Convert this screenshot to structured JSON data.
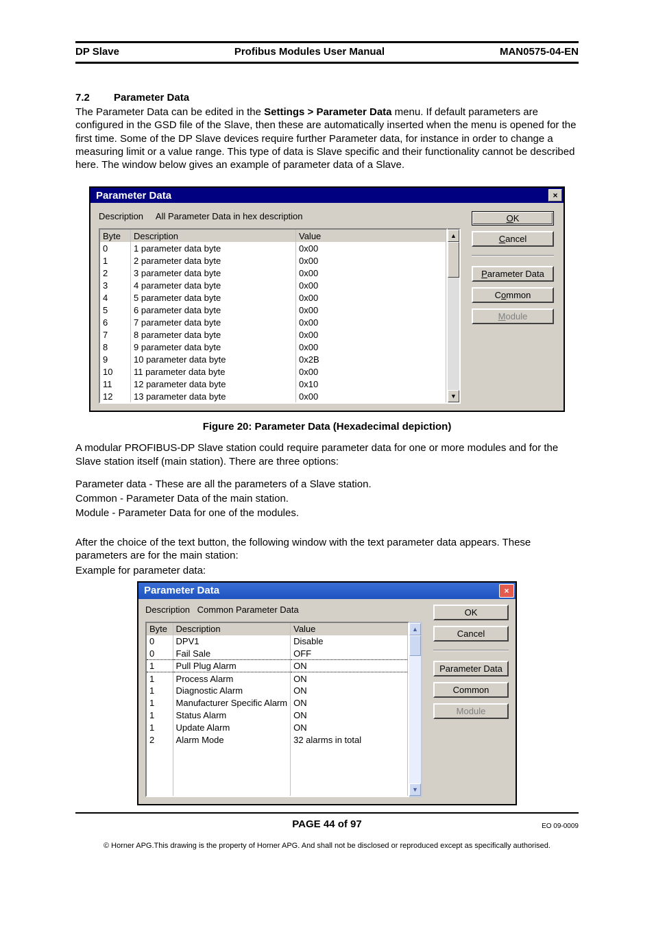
{
  "header": {
    "left": "DP Slave",
    "center": "Profibus Modules User Manual",
    "right": "MAN0575-04-EN"
  },
  "section": {
    "num": "7.2",
    "title": "Parameter Data"
  },
  "para1_a": "The Parameter Data can be edited in the ",
  "para1_b": "Settings > Parameter Data",
  "para1_c": " menu.  If default parameters are configured in the GSD file of the Slave, then these are automatically inserted when the menu is opened for the first time.  Some of the DP Slave devices require further Parameter data, for instance in order to change a measuring limit or a value range.  This type of data is Slave specific and their functionality cannot be described here.  The window below gives an example of parameter data of a Slave.",
  "dialog1": {
    "title": "Parameter Data",
    "descLabel": "Description",
    "descText": "All Parameter Data in hex description",
    "headers": {
      "byte": "Byte",
      "desc": "Description",
      "value": "Value"
    },
    "rows": [
      {
        "b": "0",
        "d": "1 parameter data byte",
        "v": "0x00"
      },
      {
        "b": "1",
        "d": "2 parameter data byte",
        "v": "0x00"
      },
      {
        "b": "2",
        "d": "3 parameter data byte",
        "v": "0x00"
      },
      {
        "b": "3",
        "d": "4 parameter data byte",
        "v": "0x00"
      },
      {
        "b": "4",
        "d": "5 parameter data byte",
        "v": "0x00"
      },
      {
        "b": "5",
        "d": "6 parameter data byte",
        "v": "0x00"
      },
      {
        "b": "6",
        "d": "7 parameter data byte",
        "v": "0x00"
      },
      {
        "b": "7",
        "d": "8 parameter data byte",
        "v": "0x00"
      },
      {
        "b": "8",
        "d": "9 parameter data byte",
        "v": "0x00"
      },
      {
        "b": "9",
        "d": "10 parameter data byte",
        "v": "0x2B"
      },
      {
        "b": "10",
        "d": "11 parameter data byte",
        "v": "0x00"
      },
      {
        "b": "11",
        "d": "12 parameter data byte",
        "v": "0x10"
      },
      {
        "b": "12",
        "d": "13 parameter data byte",
        "v": "0x00"
      }
    ],
    "buttons": {
      "ok": "OK",
      "cancel": "Cancel",
      "param": "Parameter Data",
      "common": "Common",
      "module": "Module"
    },
    "okU": "O",
    "cancelU": "C",
    "paramU": "P",
    "commonU": "o",
    "moduleU": "M"
  },
  "figcap": "Figure 20: Parameter Data (Hexadecimal depiction)",
  "para2": "A modular PROFIBUS-DP Slave station could require parameter data for one or more modules and for the Slave station itself (main station).  There are three options:",
  "bul1": "Parameter data - These are all the parameters of a Slave station.",
  "bul2": "Common - Parameter Data of the main station.",
  "bul3": "Module - Parameter Data for one of the modules.",
  "para3": "After the choice of the text button, the following window with the text parameter data appears.  These parameters are for the main station:",
  "para4": "Example for parameter data:",
  "dialog2": {
    "title": "Parameter Data",
    "descLabel": "Description",
    "descText": "Common Parameter Data",
    "headers": {
      "byte": "Byte",
      "desc": "Description",
      "value": "Value"
    },
    "rows": [
      {
        "b": "0",
        "d": "DPV1",
        "v": "Disable"
      },
      {
        "b": "0",
        "d": "Fail Sale",
        "v": "OFF"
      },
      {
        "b": "1",
        "d": "Pull Plug Alarm",
        "v": "ON",
        "sel": true
      },
      {
        "b": "1",
        "d": "Process Alarm",
        "v": "ON"
      },
      {
        "b": "1",
        "d": "Diagnostic Alarm",
        "v": "ON"
      },
      {
        "b": "1",
        "d": "Manufacturer Specific Alarm",
        "v": "ON"
      },
      {
        "b": "1",
        "d": "Status Alarm",
        "v": "ON"
      },
      {
        "b": "1",
        "d": "Update Alarm",
        "v": "ON"
      },
      {
        "b": "2",
        "d": "Alarm Mode",
        "v": "32 alarms in total"
      }
    ],
    "buttons": {
      "ok": "OK",
      "cancel": "Cancel",
      "param": "Parameter Data",
      "common": "Common",
      "module": "Module"
    }
  },
  "footer": {
    "page": "PAGE 44 of 97",
    "eo": "EO 09-0009",
    "copy": "© Horner APG.This drawing is the property of Horner APG. And shall not be disclosed or reproduced except as specifically authorised."
  }
}
